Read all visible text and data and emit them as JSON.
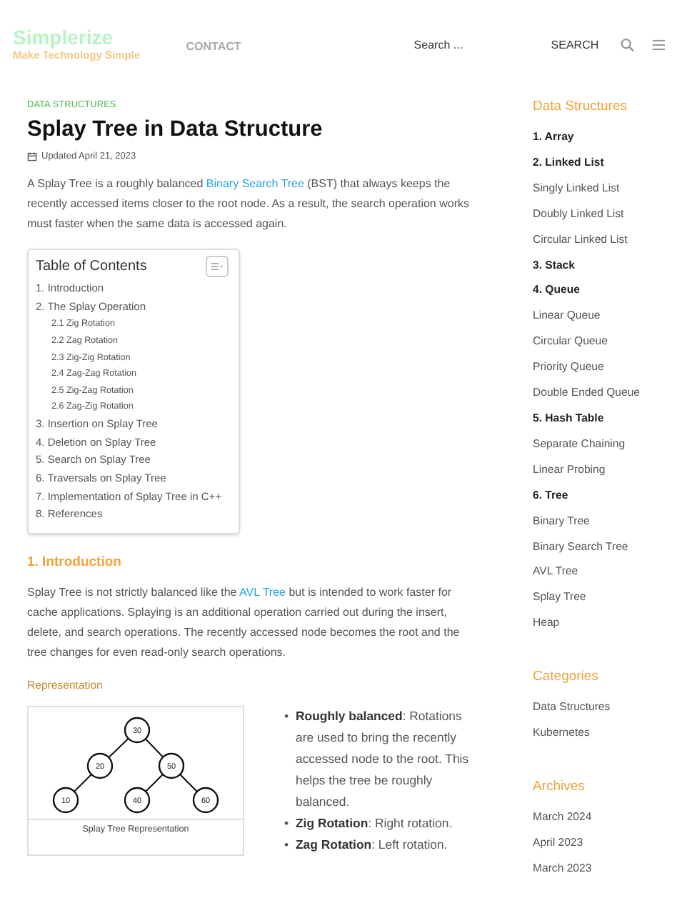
{
  "header": {
    "logo": "Simplerize",
    "tagline": "Make Technology Simple",
    "nav": [
      "CONTACT"
    ],
    "search": {
      "placeholder": "Search ..."
    },
    "search_button": "SEARCH"
  },
  "article": {
    "category": "DATA STRUCTURES",
    "title": "Splay Tree in Data Structure",
    "updated": "Updated April 21, 2023",
    "intro": [
      {
        "text": "A Splay Tree is a roughly balanced "
      },
      {
        "link": "Binary Search Tree"
      },
      {
        "text": " (BST) that always keeps the recently accessed items closer to the root node. As a result, the search operation works must faster when the same data is accessed again."
      }
    ],
    "toc": {
      "title": "Table of Contents",
      "items": [
        {
          "label": "1. Introduction"
        },
        {
          "label": "2. The Splay Operation",
          "children": [
            {
              "label": "2.1 Zig Rotation"
            },
            {
              "label": "2.2 Zag Rotation"
            },
            {
              "label": "2.3 Zig-Zig Rotation"
            },
            {
              "label": "2.4 Zag-Zag Rotation"
            },
            {
              "label": "2.5 Zig-Zag Rotation"
            },
            {
              "label": "2.6 Zag-Zig Rotation"
            }
          ]
        },
        {
          "label": "3. Insertion on Splay Tree"
        },
        {
          "label": "4. Deletion on Splay Tree"
        },
        {
          "label": "5. Search on Splay Tree"
        },
        {
          "label": "6. Traversals on Splay Tree"
        },
        {
          "label": "7. Implementation of Splay Tree in C++"
        },
        {
          "label": "8. References"
        }
      ]
    },
    "section_heading": "1. Introduction",
    "section_text": [
      {
        "text": "Splay Tree is not strictly balanced like the "
      },
      {
        "link": "AVL Tree"
      },
      {
        "text": " but is intended to work faster for cache applications. Splaying is an additional operation carried out during the insert, delete, and search operations. The recently accessed node becomes the root and the tree changes for even read-only search operations."
      }
    ],
    "subheading": "Representation",
    "figure": {
      "nodes": [
        "30",
        "20",
        "50",
        "10",
        "40",
        "60"
      ],
      "caption": "Splay Tree Representation"
    },
    "bullets": [
      {
        "marker": "•",
        "text": "**Roughly balanced**: Rotations are used to bring the recently accessed node to the root. This helps the tree be roughly balanced."
      },
      {
        "marker": "•",
        "text": "**Zig Rotation**: Right rotation."
      },
      {
        "marker": "•",
        "text": "**Zag Rotation**: Left rotation."
      }
    ]
  },
  "sidebar": [
    {
      "title": "Data Structures",
      "items": [
        {
          "label": "1. Array",
          "kind": "heading"
        },
        {
          "label": "2. Linked List",
          "kind": "heading"
        },
        {
          "label": "Singly Linked List",
          "kind": "link"
        },
        {
          "label": "Doubly Linked List",
          "kind": "link"
        },
        {
          "label": "Circular Linked List",
          "kind": "link"
        },
        {
          "label": "3. Stack",
          "kind": "heading"
        },
        {
          "label": "4. Queue",
          "kind": "heading"
        },
        {
          "label": "Linear Queue",
          "kind": "link"
        },
        {
          "label": "Circular Queue",
          "kind": "link"
        },
        {
          "label": "Priority Queue",
          "kind": "link"
        },
        {
          "label": "Double Ended Queue",
          "kind": "link"
        },
        {
          "label": "5. Hash Table",
          "kind": "heading"
        },
        {
          "label": "Separate Chaining",
          "kind": "link"
        },
        {
          "label": "Linear Probing",
          "kind": "link"
        },
        {
          "label": "6. Tree",
          "kind": "heading"
        },
        {
          "label": "Binary Tree",
          "kind": "link"
        },
        {
          "label": "Binary Search Tree",
          "kind": "link"
        },
        {
          "label": "AVL Tree",
          "kind": "link"
        },
        {
          "label": "Splay Tree",
          "kind": "link"
        },
        {
          "label": "Heap",
          "kind": "link"
        }
      ]
    },
    {
      "title": "Categories",
      "items": [
        {
          "label": "Data Structures",
          "kind": "link"
        },
        {
          "label": "Kubernetes",
          "kind": "link"
        }
      ]
    },
    {
      "title": "Archives",
      "items": [
        {
          "label": "March 2024",
          "kind": "link"
        },
        {
          "label": "April 2023",
          "kind": "link"
        },
        {
          "label": "March 2023",
          "kind": "link"
        }
      ]
    }
  ]
}
